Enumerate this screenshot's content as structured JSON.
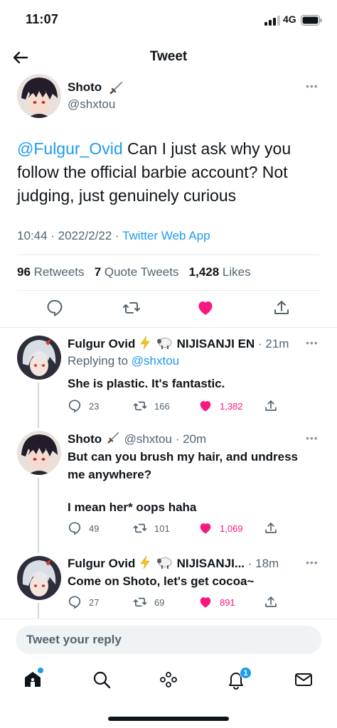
{
  "status_bar": {
    "time": "11:07",
    "network": "4G"
  },
  "header": {
    "title": "Tweet"
  },
  "main_tweet": {
    "name": "Shoto",
    "handle": "@shxtou",
    "mention": "@Fulgur_Ovid",
    "text": " Can I just ask why you follow the official barbie account? Not judging, just genuinely curious",
    "time": "10:44 · 2022/2/22 · ",
    "source": "Twitter Web App",
    "retweets": "96",
    "retweets_label": " Retweets",
    "quotes": "7",
    "quotes_label": " Quote Tweets",
    "likes": "1,428",
    "likes_label": " Likes"
  },
  "replies": [
    {
      "name": "Fulgur Ovid",
      "org": "NIJISANJI EN",
      "time": "· 21m",
      "replying_prefix": "Replying to ",
      "replying_to": "@shxtou",
      "text": "She is plastic. It's fantastic.",
      "replies": "23",
      "retweets": "166",
      "likes": "1,382"
    },
    {
      "name": "Shoto",
      "handle": "@shxtou",
      "time": "· 20m",
      "text_line1": "But can you brush my hair, and undress me anywhere?",
      "text_line2": "I mean her* oops haha",
      "replies": "49",
      "retweets": "101",
      "likes": "1,069"
    },
    {
      "name": "Fulgur Ovid",
      "org": "NIJISANJI...",
      "time": "· 18m",
      "text": "Come on Shoto, let's get cocoa~",
      "replies": "27",
      "retweets": "69",
      "likes": "891"
    }
  ],
  "reply_box": {
    "placeholder": "Tweet your reply"
  },
  "nav": {
    "items": [
      "home-icon",
      "search-icon",
      "spaces-icon",
      "notifications-icon",
      "messages-icon"
    ],
    "notification_count": "1"
  },
  "colors": {
    "accent": "#1d9bf0",
    "like": "#f91880",
    "text": "#0f1419",
    "muted": "#536471"
  }
}
